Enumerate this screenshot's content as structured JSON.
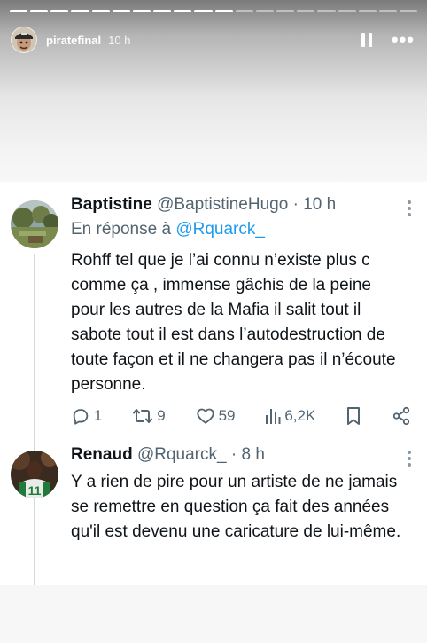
{
  "story": {
    "username": "piratefinal",
    "time": "10 h",
    "progress_total": 20,
    "progress_done": 11
  },
  "tweets": [
    {
      "name": "Baptistine",
      "handle": "@BaptistineHugo",
      "dot": "·",
      "time": "10 h",
      "reply_prefix": "En réponse à",
      "reply_mention": "@Rquarck_",
      "text": "Rohff tel que je l’ai connu n’existe plus c comme ça , immense gâchis de la peine pour les autres de la Mafia il salit tout il sabote tout il est dans l’autodestruction de toute façon et il ne changera pas il n’écoute personne.",
      "replies": "1",
      "retweets": "9",
      "likes": "59",
      "views": "6,2K"
    },
    {
      "name": "Renaud",
      "handle": "@Rquarck_",
      "dot": "·",
      "time": "8 h",
      "text": "Y a rien de pire pour un artiste de ne jamais se remettre en question ça fait des années qu'il est devenu une caricature de lui-même.",
      "jersey_number": "11"
    }
  ],
  "colors": {
    "text": "#0f1419",
    "secondary": "#536471",
    "link": "#1d9bf0",
    "thread_line": "#cfd9de"
  },
  "icons": [
    "pause-icon",
    "more-icon",
    "kebab-icon",
    "reply-icon",
    "retweet-icon",
    "like-icon",
    "views-icon",
    "bookmark-icon",
    "share-icon"
  ]
}
